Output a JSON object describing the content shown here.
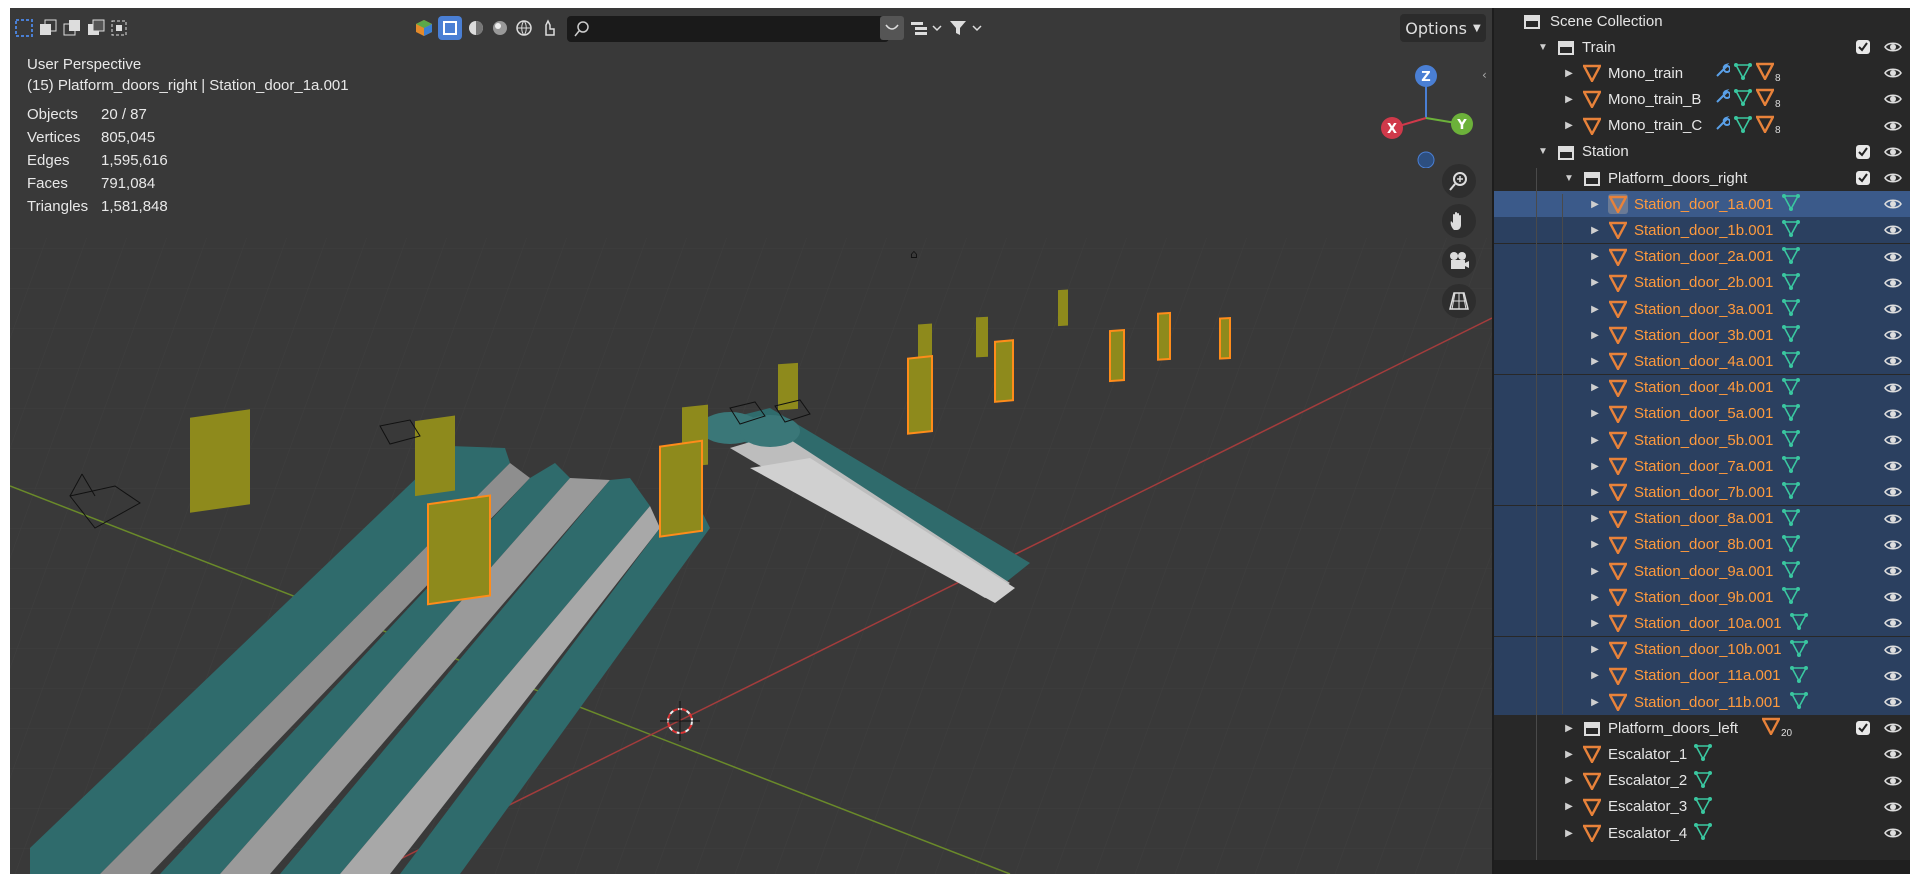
{
  "viewport": {
    "view_name": "User Perspective",
    "context": "(15) Platform_doors_right | Station_door_1a.001",
    "options_label": "Options",
    "search_placeholder": "",
    "stats": [
      {
        "key": "Objects",
        "value": "20 / 87"
      },
      {
        "key": "Vertices",
        "value": "805,045"
      },
      {
        "key": "Edges",
        "value": "1,595,616"
      },
      {
        "key": "Faces",
        "value": "791,084"
      },
      {
        "key": "Triangles",
        "value": "1,581,848"
      }
    ],
    "gizmo": {
      "x": "X",
      "y": "Y",
      "z": "Z"
    }
  },
  "outliner": {
    "root": "Scene Collection",
    "rows": [
      {
        "label": "Train",
        "kind": "collection",
        "depth": 1,
        "expanded": true,
        "checkbox": true
      },
      {
        "label": "Mono_train",
        "kind": "object",
        "depth": 2,
        "mods": true,
        "mat_count": "8"
      },
      {
        "label": "Mono_train_B",
        "kind": "object",
        "depth": 2,
        "mods": true,
        "mat_count": "8"
      },
      {
        "label": "Mono_train_C",
        "kind": "object",
        "depth": 2,
        "mods": true,
        "mat_count": "8"
      },
      {
        "label": "Station",
        "kind": "collection",
        "depth": 1,
        "expanded": true,
        "checkbox": true
      },
      {
        "label": "Platform_doors_right",
        "kind": "collection",
        "depth": 2,
        "expanded": true,
        "checkbox": true
      },
      {
        "label": "Station_door_1a.001",
        "kind": "object",
        "depth": 3,
        "selected": true,
        "active": true
      },
      {
        "label": "Station_door_1b.001",
        "kind": "object",
        "depth": 3,
        "selected": true
      },
      {
        "label": "Station_door_2a.001",
        "kind": "object",
        "depth": 3,
        "selected": true
      },
      {
        "label": "Station_door_2b.001",
        "kind": "object",
        "depth": 3,
        "selected": true
      },
      {
        "label": "Station_door_3a.001",
        "kind": "object",
        "depth": 3,
        "selected": true
      },
      {
        "label": "Station_door_3b.001",
        "kind": "object",
        "depth": 3,
        "selected": true
      },
      {
        "label": "Station_door_4a.001",
        "kind": "object",
        "depth": 3,
        "selected": true
      },
      {
        "label": "Station_door_4b.001",
        "kind": "object",
        "depth": 3,
        "selected": true
      },
      {
        "label": "Station_door_5a.001",
        "kind": "object",
        "depth": 3,
        "selected": true
      },
      {
        "label": "Station_door_5b.001",
        "kind": "object",
        "depth": 3,
        "selected": true
      },
      {
        "label": "Station_door_7a.001",
        "kind": "object",
        "depth": 3,
        "selected": true
      },
      {
        "label": "Station_door_7b.001",
        "kind": "object",
        "depth": 3,
        "selected": true
      },
      {
        "label": "Station_door_8a.001",
        "kind": "object",
        "depth": 3,
        "selected": true
      },
      {
        "label": "Station_door_8b.001",
        "kind": "object",
        "depth": 3,
        "selected": true
      },
      {
        "label": "Station_door_9a.001",
        "kind": "object",
        "depth": 3,
        "selected": true
      },
      {
        "label": "Station_door_9b.001",
        "kind": "object",
        "depth": 3,
        "selected": true
      },
      {
        "label": "Station_door_10a.001",
        "kind": "object",
        "depth": 3,
        "selected": true
      },
      {
        "label": "Station_door_10b.001",
        "kind": "object",
        "depth": 3,
        "selected": true
      },
      {
        "label": "Station_door_11a.001",
        "kind": "object",
        "depth": 3,
        "selected": true
      },
      {
        "label": "Station_door_11b.001",
        "kind": "object",
        "depth": 3,
        "selected": true
      },
      {
        "label": "Platform_doors_left",
        "kind": "collection",
        "depth": 2,
        "expanded": false,
        "checkbox": true,
        "count": "20"
      },
      {
        "label": "Escalator_1",
        "kind": "object",
        "depth": 2
      },
      {
        "label": "Escalator_2",
        "kind": "object",
        "depth": 2
      },
      {
        "label": "Escalator_3",
        "kind": "object",
        "depth": 2
      },
      {
        "label": "Escalator_4",
        "kind": "object",
        "depth": 2
      }
    ]
  },
  "colors": {
    "viewport_bg": "#393939",
    "outliner_bg": "#282828",
    "selected_row": "#2b4060",
    "active_row": "#3b5a8a",
    "selected_text": "#ff9a3d",
    "escalator_teal": "#2f6b6c",
    "door_yellow": "#8e8a1c",
    "door_orange": "#ff8c1a",
    "axis_red": "#a33c3c",
    "axis_green": "#6a8a2a"
  }
}
